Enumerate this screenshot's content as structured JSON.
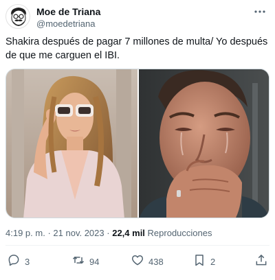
{
  "author": {
    "name": "Moe de Triana",
    "handle": "@moedetriana"
  },
  "tweet": {
    "text": "Shakira después de pagar 7 millones de multa/ Yo después de que me carguen el IBI."
  },
  "meta": {
    "time": "4:19 p. m.",
    "separator": "·",
    "date": "21 nov. 2023",
    "views_count": "22,4 mil",
    "views_label": "Reproducciones"
  },
  "actions": {
    "replies": "3",
    "retweets": "94",
    "likes": "438",
    "bookmarks": "2"
  },
  "icons": {
    "more": "more-dots-icon",
    "reply": "reply-icon",
    "retweet": "retweet-icon",
    "like": "heart-icon",
    "bookmark": "bookmark-icon",
    "share": "share-icon"
  },
  "colors": {
    "text_primary": "#0f1419",
    "text_secondary": "#536471",
    "divider": "#eff3f4"
  }
}
